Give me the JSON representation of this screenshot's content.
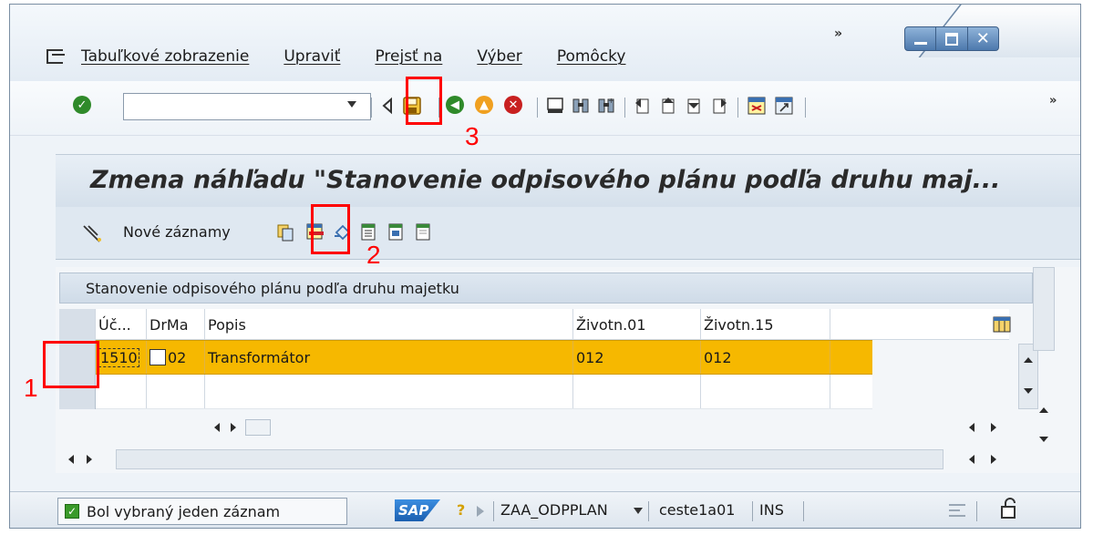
{
  "menu": {
    "items": [
      "Tabuľkové zobrazenie",
      "Upraviť",
      "Prejsť na",
      "Výber",
      "Pomôcky"
    ]
  },
  "toolbar": {
    "command_field_value": "",
    "icons": [
      "enter-check-icon",
      "command-dropdown-icon",
      "back-triangle-icon",
      "save-icon",
      "back-icon",
      "exit-icon",
      "cancel-icon",
      "print-icon",
      "find-icon",
      "find-next-icon",
      "first-page-icon",
      "prev-page-icon",
      "next-page-icon",
      "last-page-icon",
      "new-session-icon",
      "shortcut-icon"
    ]
  },
  "screen": {
    "title": "Zmena náhľadu \"Stanovenie odpisového plánu podľa druhu maj..."
  },
  "app_toolbar": {
    "new_entries_label": "Nové záznamy",
    "icons": [
      "glasses-icon",
      "copy-as-icon",
      "delete-icon",
      "undo-icon",
      "select-all-icon",
      "select-block-icon",
      "deselect-all-icon"
    ]
  },
  "table": {
    "caption": "Stanovenie odpisového plánu podľa druhu majetku",
    "columns": [
      "Úč...",
      "DrMa",
      "Popis",
      "Životn.01",
      "Životn.15"
    ],
    "rows": [
      {
        "uc": "1510",
        "drma": "02",
        "popis": "Transformátor",
        "zivotn01": "012",
        "zivotn15": "012"
      },
      {
        "uc": "",
        "drma": "",
        "popis": "",
        "zivotn01": "",
        "zivotn15": ""
      }
    ]
  },
  "status": {
    "message": "Bol vybraný jeden záznam",
    "sap_logo": "SAP",
    "transaction": "ZAA_ODPPLAN",
    "user": "ceste1a01",
    "mode": "INS"
  },
  "annotations": {
    "step1": "1",
    "step2": "2",
    "step3": "3"
  },
  "colors": {
    "highlight_row": "#f6b800",
    "annotation_red": "#ff0000",
    "window_buttons": "#5a86bb"
  }
}
